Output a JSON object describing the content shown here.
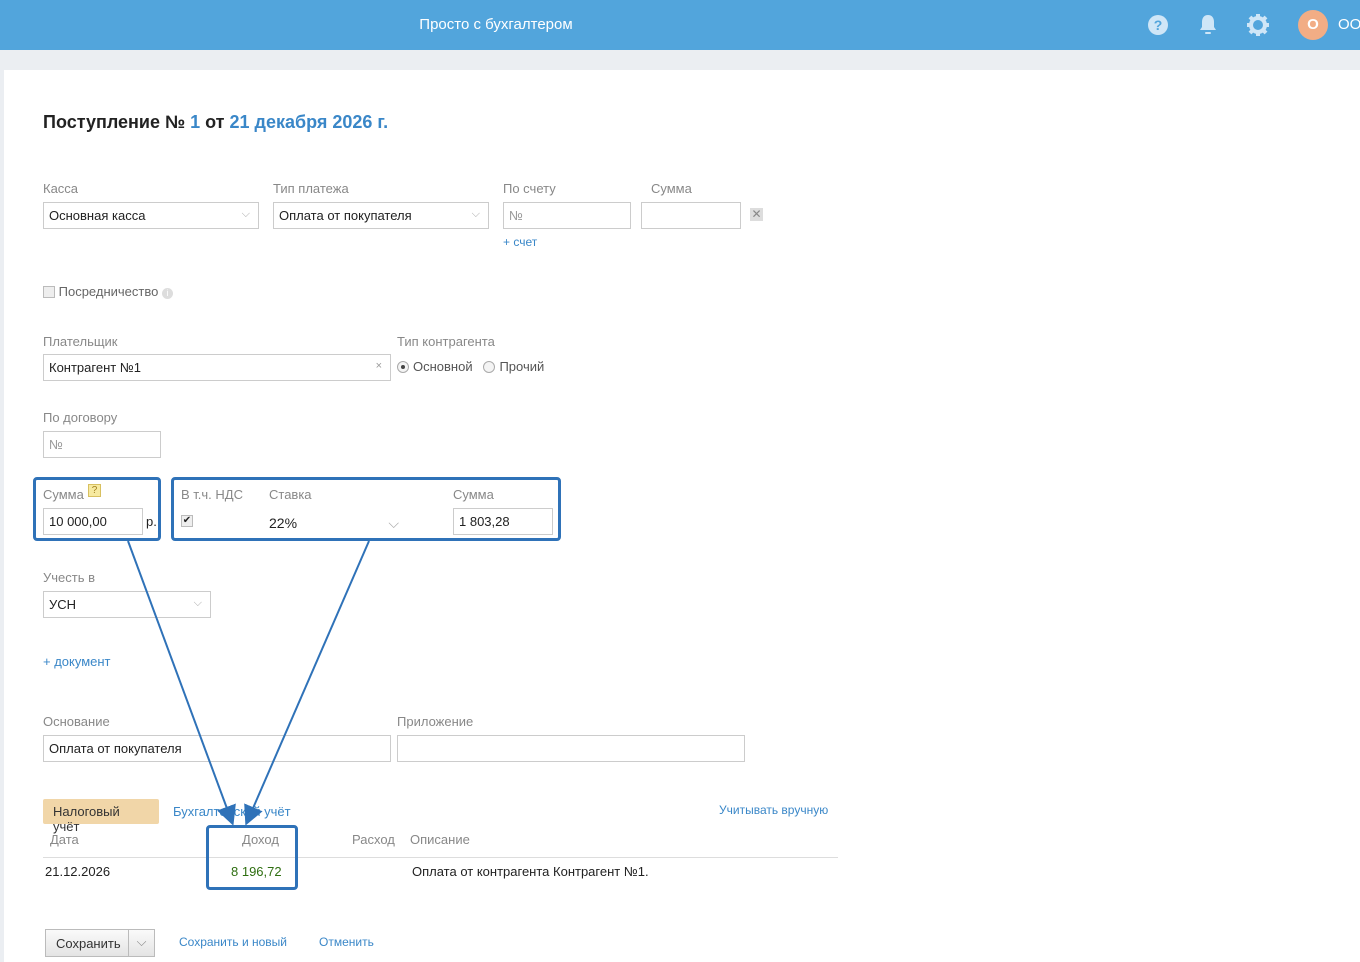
{
  "header": {
    "title": "Просто с бухгалтером",
    "avatar_letter": "О",
    "user": "ОО",
    "icons": [
      "help-icon",
      "bell-icon",
      "gear-icon"
    ]
  },
  "doc": {
    "title_prefix": "Поступление №",
    "number": "1",
    "from": "от",
    "date": "21 декабря 2026 г."
  },
  "fields": {
    "kassa_label": "Касса",
    "kassa_value": "Основная касса",
    "paytype_label": "Тип платежа",
    "paytype_value": "Оплата от покупателя",
    "invoice_label": "По счету",
    "invoice_placeholder": "№",
    "add_invoice": "+ счет",
    "sum_top_label": "Сумма",
    "agency_label": "Посредничество",
    "payer_label": "Плательщик",
    "payer_value": "Контрагент №1",
    "ctype_label": "Тип контрагента",
    "ctype_options": [
      "Основной",
      "Прочий"
    ],
    "contract_label": "По договору",
    "contract_placeholder": "№",
    "sum_label": "Сумма",
    "sum_value": "10 000,00",
    "currency": "р.",
    "vat_incl_label": "В т.ч. НДС",
    "rate_label": "Ставка",
    "rate_value": "22%",
    "vat_sum_label": "Сумма",
    "vat_sum_value": "1 803,28",
    "account_in_label": "Учесть в",
    "account_in_value": "УСН",
    "add_document": "+ документ",
    "basis_label": "Основание",
    "basis_value": "Оплата от покупателя",
    "attachment_label": "Приложение"
  },
  "ledger": {
    "tabs": [
      "Налоговый учёт",
      "Бухгалтерский учёт"
    ],
    "manual": "Учитывать вручную",
    "columns": [
      "Дата",
      "Доход",
      "Расход",
      "Описание"
    ],
    "rows": [
      {
        "date": "21.12.2026",
        "income": "8 196,72",
        "expense": "",
        "desc": "Оплата от контрагента Контрагент №1."
      }
    ]
  },
  "actions": {
    "save": "Сохранить",
    "save_new": "Сохранить и новый",
    "cancel": "Отменить"
  }
}
